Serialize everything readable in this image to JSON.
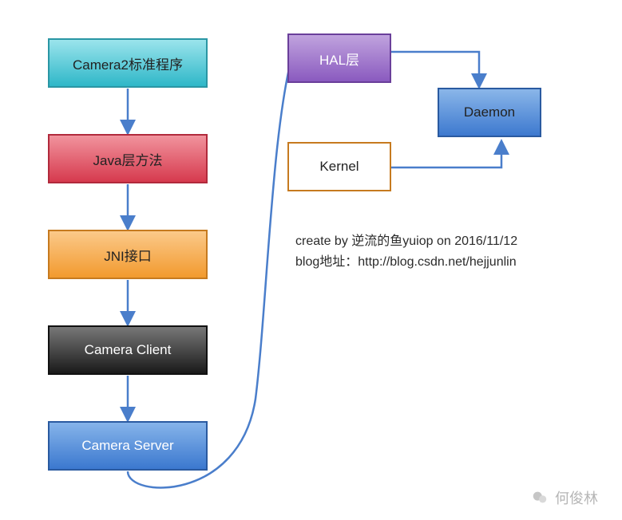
{
  "chart_data": {
    "type": "diagram",
    "title": "",
    "nodes": [
      {
        "id": "camera2",
        "label": "Camera2标准程序"
      },
      {
        "id": "java_layer",
        "label": "Java层方法"
      },
      {
        "id": "jni",
        "label": "JNI接口"
      },
      {
        "id": "camera_client",
        "label": "Camera Client"
      },
      {
        "id": "camera_server",
        "label": "Camera Server"
      },
      {
        "id": "hal",
        "label": "HAL层"
      },
      {
        "id": "daemon",
        "label": "Daemon"
      },
      {
        "id": "kernel",
        "label": "Kernel"
      }
    ],
    "edges": [
      {
        "from": "camera2",
        "to": "java_layer"
      },
      {
        "from": "java_layer",
        "to": "jni"
      },
      {
        "from": "jni",
        "to": "camera_client"
      },
      {
        "from": "camera_client",
        "to": "camera_server"
      },
      {
        "from": "camera_server",
        "to": "hal"
      },
      {
        "from": "hal",
        "to": "daemon"
      },
      {
        "from": "kernel",
        "to": "daemon"
      }
    ],
    "caption_line1": "create by 逆流的鱼yuiop on 2016/11/12",
    "caption_line2": "blog地址：http://blog.csdn.net/hejjunlin"
  },
  "watermark": {
    "name": "何俊林"
  },
  "colors": {
    "arrow": "#4a7ecb"
  }
}
